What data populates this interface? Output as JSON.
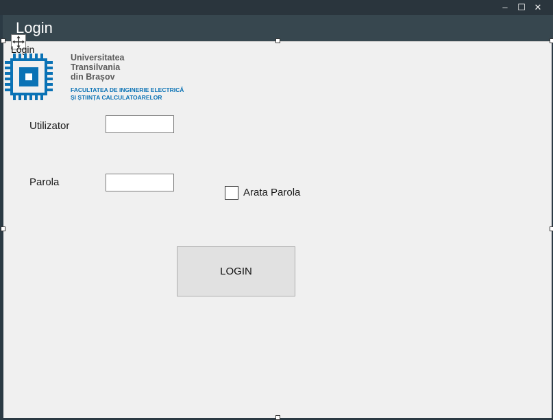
{
  "window": {
    "minimize_glyph": "–",
    "maximize_glyph": "☐",
    "close_glyph": "✕"
  },
  "header": {
    "title": "Login"
  },
  "form": {
    "caption": "Login"
  },
  "logo": {
    "icon": "chip-logo-icon",
    "university_line1": "Universitatea",
    "university_line2": "Transilvania",
    "university_line3": "din Brașov",
    "faculty_line1": "FACULTATEA DE INGINERIE ELECTRICĂ",
    "faculty_line2": "ȘI ȘTIINȚA CALCULATOARELOR"
  },
  "fields": {
    "username_label": "Utilizator",
    "username_value": "",
    "password_label": "Parola",
    "password_value": ""
  },
  "show_password": {
    "label": "Arata Parola",
    "checked": false
  },
  "login_button": {
    "label": "LOGIN"
  },
  "colors": {
    "header_bg": "#37474f",
    "titlebar_bg": "#2a353d",
    "form_bg": "#f0f0f0",
    "logo_blue": "#0a72b5"
  }
}
